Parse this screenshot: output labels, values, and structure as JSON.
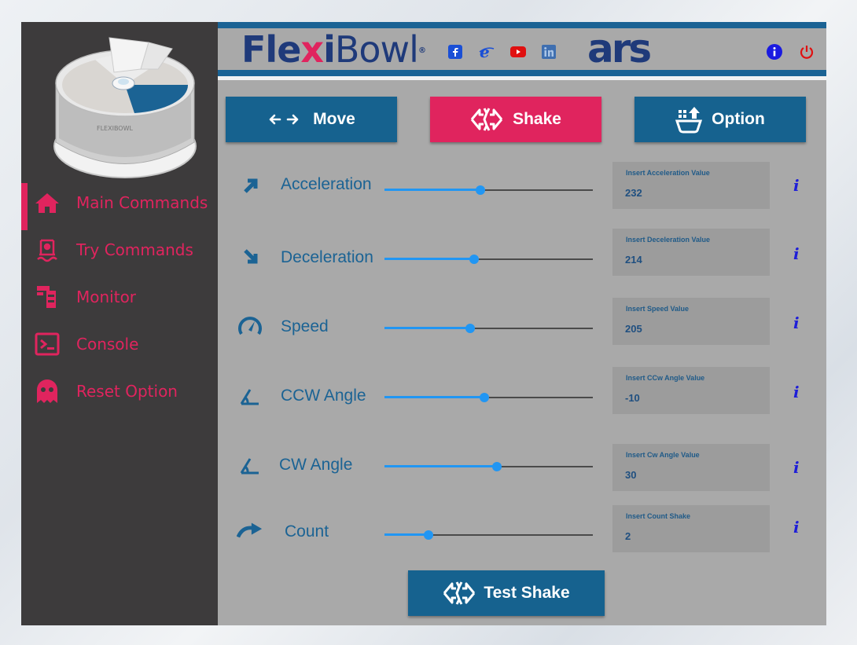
{
  "brand": {
    "flexi_a": "Fle",
    "flexi_x": "x",
    "flexi_b": "i",
    "bowl": "Bowl",
    "reg": "®",
    "partner": "ars"
  },
  "machine_label": "FLEXIBOWL",
  "sidebar": {
    "items": [
      {
        "label": "Main Commands",
        "icon": "home-icon",
        "active": true
      },
      {
        "label": "Try Commands",
        "icon": "try-commands-icon",
        "active": false
      },
      {
        "label": "Monitor",
        "icon": "monitor-icon",
        "active": false
      },
      {
        "label": "Console",
        "icon": "console-icon",
        "active": false
      },
      {
        "label": "Reset Option",
        "icon": "ghost-icon",
        "active": false
      }
    ]
  },
  "social": [
    "facebook-icon",
    "ie-icon",
    "youtube-icon",
    "linkedin-icon"
  ],
  "tabs": [
    {
      "label": "Move",
      "icon": "arrows-left-right-icon",
      "active": false
    },
    {
      "label": "Shake",
      "icon": "shake-icon",
      "active": true
    },
    {
      "label": "Option",
      "icon": "option-icon",
      "active": false
    }
  ],
  "params": [
    {
      "label": "Acceleration",
      "placeholder": "Insert Acceleration Value",
      "value": "232",
      "slider_fraction": 0.46,
      "icon": "arrow-up-right-icon"
    },
    {
      "label": "Deceleration",
      "placeholder": "Insert Deceleration Value",
      "value": "214",
      "slider_fraction": 0.43,
      "icon": "arrow-down-right-icon"
    },
    {
      "label": "Speed",
      "placeholder": "Insert Speed Value",
      "value": "205",
      "slider_fraction": 0.41,
      "icon": "speedometer-icon"
    },
    {
      "label": "CCW Angle",
      "placeholder": "Insert CCw Angle Value",
      "value": "-10",
      "slider_fraction": 0.48,
      "icon": "angle-icon"
    },
    {
      "label": "CW Angle",
      "placeholder": "Insert Cw Angle Value",
      "value": "30",
      "slider_fraction": 0.54,
      "icon": "angle-icon"
    },
    {
      "label": "Count",
      "placeholder": "Insert Count Shake",
      "value": "2",
      "slider_fraction": 0.21,
      "icon": "redo-arrow-icon"
    }
  ],
  "info_label": "i",
  "test_button": {
    "label": "Test Shake"
  },
  "colors": {
    "accent": "#e0245e",
    "primary": "#16628f",
    "slider": "#2196f3",
    "sidebar_bg": "#3d3b3c",
    "panel_bg": "#a9a9a9"
  }
}
